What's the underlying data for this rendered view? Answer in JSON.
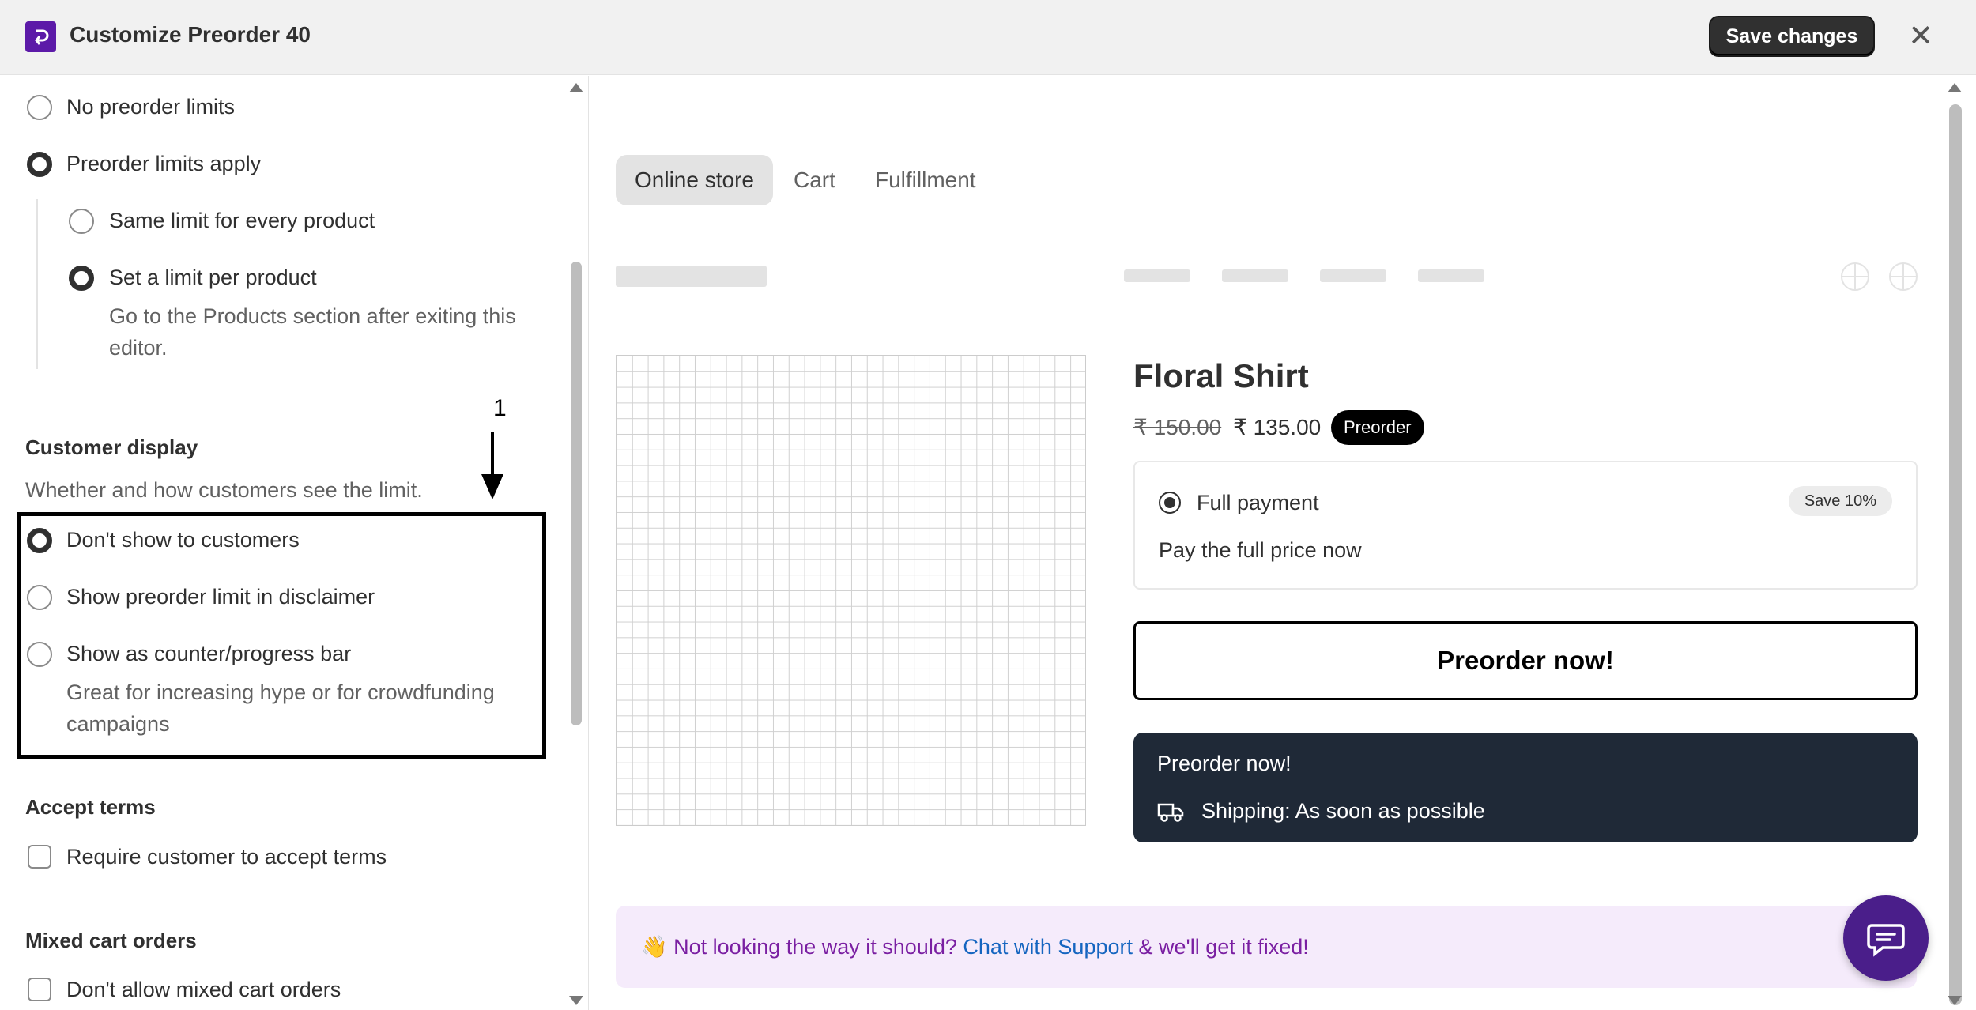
{
  "header": {
    "title": "Customize Preorder 40",
    "save_label": "Save changes",
    "close_glyph": "✕"
  },
  "left": {
    "limits": {
      "no_limits": "No preorder limits",
      "limits_apply": "Preorder limits apply",
      "same_limit": "Same limit for every product",
      "per_product": "Set a limit per product",
      "per_product_help_1": "Go to the Products section after exiting this",
      "per_product_help_2": "editor."
    },
    "customer_display": {
      "title": "Customer display",
      "help": "Whether and how customers see the limit.",
      "dont_show": "Don't show to customers",
      "disclaimer": "Show preorder limit in disclaimer",
      "counter": "Show as counter/progress bar",
      "counter_help_1": "Great for increasing hype or for crowdfunding",
      "counter_help_2": "campaigns"
    },
    "annotation_number": "1",
    "accept_terms": {
      "title": "Accept terms",
      "require": "Require customer to accept terms"
    },
    "mixed_cart": {
      "title": "Mixed cart orders",
      "dont_allow": "Don't allow mixed cart orders"
    }
  },
  "preview": {
    "tabs": [
      {
        "label": "Online store",
        "active": true
      },
      {
        "label": "Cart",
        "active": false
      },
      {
        "label": "Fulfillment",
        "active": false
      }
    ],
    "product": {
      "title": "Floral Shirt",
      "old_price": "₹ 150.00",
      "new_price": "₹ 135.00",
      "badge": "Preorder"
    },
    "payment": {
      "title": "Full payment",
      "save_badge": "Save 10%",
      "description": "Pay the full price now"
    },
    "preorder_button": "Preorder now!",
    "info_card": {
      "title": "Preorder now!",
      "shipping": "Shipping: As soon as possible"
    },
    "support": {
      "emoji": "👋",
      "text_before": "Not looking the way it should?",
      "link": "Chat with Support",
      "text_after": "& we'll get it fixed!"
    }
  },
  "colors": {
    "brand": "#5c1aa8",
    "dark_card": "#1f2937",
    "support_bg": "#f5ebfb",
    "support_text": "#7a1fa2",
    "link": "#1565c0",
    "chat_fab": "#4a1e8a"
  }
}
